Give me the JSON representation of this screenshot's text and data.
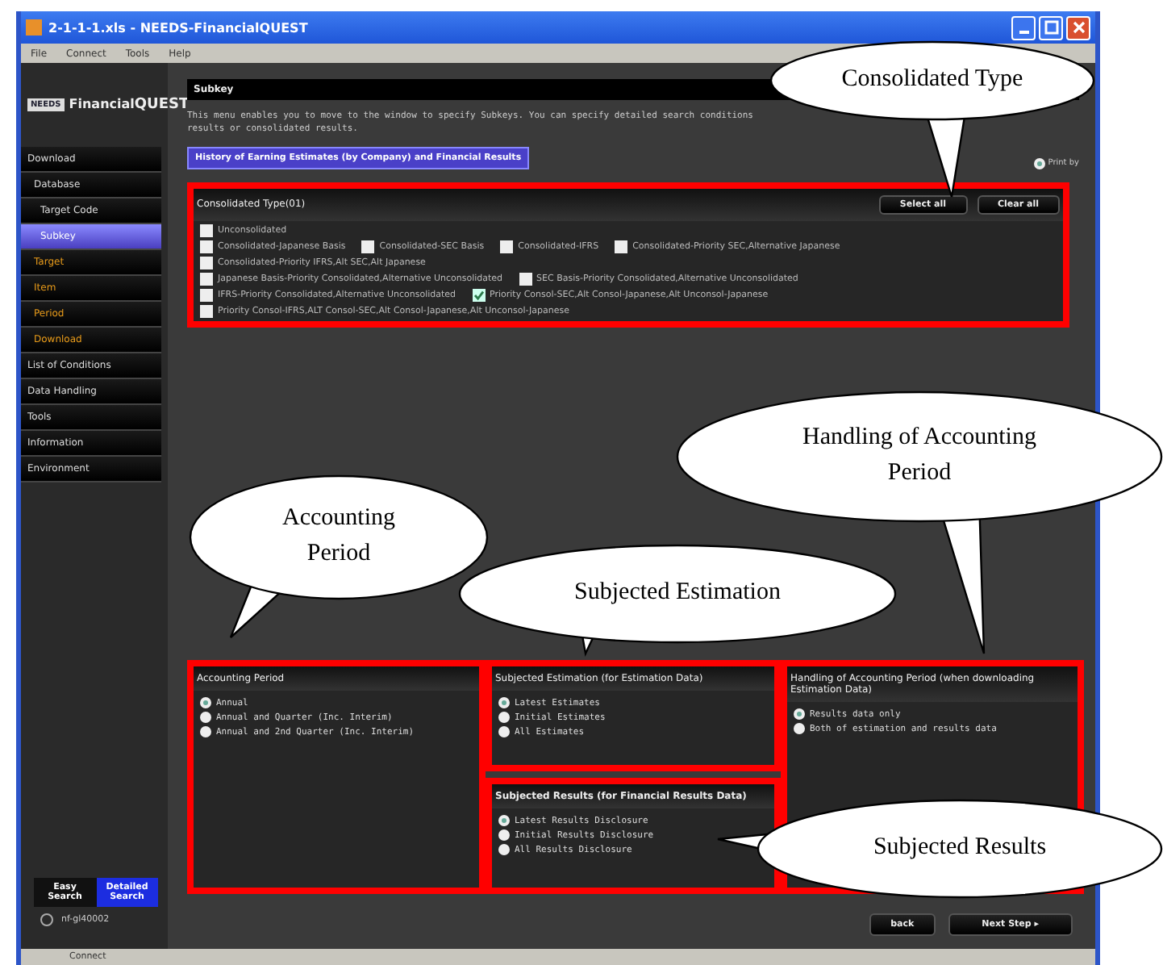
{
  "window": {
    "title": "2-1-1-1.xls - NEEDS-FinancialQUEST"
  },
  "menu": [
    "File",
    "Connect",
    "Tools",
    "Help"
  ],
  "sidebar": {
    "logo_badge": "NEEDS",
    "logo_text": "Financial",
    "logo_bold": "QUEST",
    "items": [
      {
        "label": "Download",
        "kind": "header",
        "selected": false
      },
      {
        "label": "Database",
        "kind": "item",
        "selected": false
      },
      {
        "label": "Target Code",
        "kind": "sub",
        "selected": false
      },
      {
        "label": "Subkey",
        "kind": "sub",
        "selected": true
      },
      {
        "label": "Target",
        "kind": "step",
        "selected": false
      },
      {
        "label": "Item",
        "kind": "step",
        "selected": false
      },
      {
        "label": "Period",
        "kind": "step",
        "selected": false
      },
      {
        "label": "Download",
        "kind": "step",
        "selected": false
      },
      {
        "label": "List of Conditions",
        "kind": "header",
        "selected": false
      },
      {
        "label": "Data Handling",
        "kind": "header",
        "selected": false
      },
      {
        "label": "Tools",
        "kind": "header",
        "selected": false
      },
      {
        "label": "Information",
        "kind": "header",
        "selected": false
      },
      {
        "label": "Environment",
        "kind": "header",
        "selected": false
      }
    ],
    "search_modes": [
      {
        "label": "Easy Search",
        "selected": false
      },
      {
        "label": "Detailed Search",
        "selected": true
      }
    ],
    "user": {
      "label": "nf-gl40002",
      "selected": false
    }
  },
  "content": {
    "header": "Subkey",
    "description": "This menu enables you to move to the window to specify Subkeys. You can specify detailed search conditions results or consolidated results.",
    "section_tab": "History of Earning Estimates (by Company) and Financial Results",
    "print_option": {
      "label": "Print by",
      "selected": true
    },
    "consolidated": {
      "title": "Consolidated Type(01)",
      "buttons": [
        "Select all",
        "Clear all"
      ],
      "lines": [
        {
          "items": [
            {
              "label": "Unconsolidated",
              "checked": false
            }
          ]
        },
        {
          "items": [
            {
              "label": "Consolidated-Japanese Basis",
              "checked": false
            },
            {
              "label": "Consolidated-SEC Basis",
              "checked": false
            },
            {
              "label": "Consolidated-IFRS",
              "checked": false
            },
            {
              "label": "Consolidated-Priority SEC,Alternative Japanese",
              "checked": false
            }
          ]
        },
        {
          "items": [
            {
              "label": "Consolidated-Priority IFRS,Alt SEC,Alt Japanese",
              "checked": false
            }
          ]
        },
        {
          "items": [
            {
              "label": "Japanese Basis-Priority Consolidated,Alternative Unconsolidated",
              "checked": false
            },
            {
              "label": "SEC Basis-Priority Consolidated,Alternative Unconsolidated",
              "checked": false
            }
          ]
        },
        {
          "items": [
            {
              "label": "IFRS-Priority Consolidated,Alternative Unconsolidated",
              "checked": false
            },
            {
              "label": "Priority Consol-SEC,Alt Consol-Japanese,Alt Unconsol-Japanese",
              "checked": true
            }
          ]
        },
        {
          "items": [
            {
              "label": "Priority Consol-IFRS,ALT Consol-SEC,Alt Consol-Japanese,Alt Unconsol-Japanese",
              "checked": false
            }
          ]
        }
      ]
    },
    "panels": [
      {
        "title": "Accounting Period",
        "bold": false,
        "options": [
          {
            "label": "Annual",
            "selected": true
          },
          {
            "label": "Annual and Quarter (Inc. Interim)",
            "selected": false
          },
          {
            "label": "Annual and 2nd Quarter (Inc. Interim)",
            "selected": false
          }
        ]
      },
      {
        "title": "Subjected Estimation (for Estimation Data)",
        "bold": false,
        "options": [
          {
            "label": "Latest Estimates",
            "selected": true
          },
          {
            "label": "Initial Estimates",
            "selected": false
          },
          {
            "label": "All Estimates",
            "selected": false
          }
        ]
      },
      {
        "title": "Handling of Accounting Period (when downloading Estimation Data)",
        "bold": false,
        "options": [
          {
            "label": "Results data only",
            "selected": true
          },
          {
            "label": "Both of estimation and results data",
            "selected": false
          }
        ]
      },
      {
        "title": "Subjected Results (for Financial Results Data)",
        "bold": true,
        "options": [
          {
            "label": "Latest Results Disclosure",
            "selected": true
          },
          {
            "label": "Initial Results Disclosure",
            "selected": false
          },
          {
            "label": "All Results Disclosure",
            "selected": false
          }
        ]
      }
    ],
    "footer_buttons": [
      "back",
      "Next Step ▸"
    ]
  },
  "status_bar": {
    "text": "Connect"
  },
  "callouts": [
    {
      "text": "Consolidated Type"
    },
    {
      "text": "Handling of Accounting Period"
    },
    {
      "text": "Accounting Period"
    },
    {
      "text": "Subjected Estimation"
    },
    {
      "text": "Subjected Results"
    }
  ]
}
